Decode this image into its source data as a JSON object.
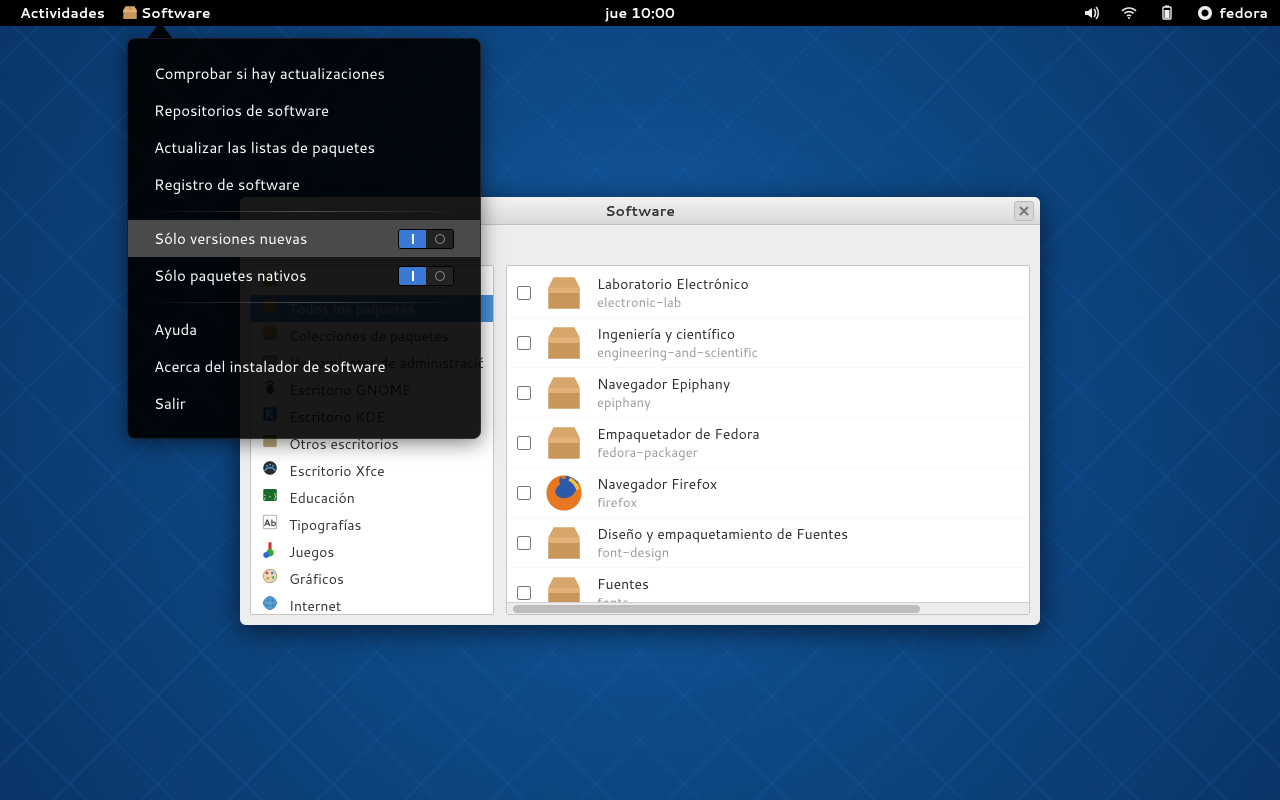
{
  "topbar": {
    "activities": "Actividades",
    "app_name": "Software",
    "clock": "jue 10:00",
    "username": "fedora"
  },
  "menu": {
    "check_updates": "Comprobar si hay actualizaciones",
    "software_repos": "Repositorios de software",
    "update_package_lists": "Actualizar las listas de paquetes",
    "software_log": "Registro de software",
    "only_new_versions": "Sólo versiones nuevas",
    "only_native_packages": "Sólo paquetes nativos",
    "help": "Ayuda",
    "about": "Acerca del instalador de software",
    "quit": "Salir"
  },
  "window": {
    "title": "Software"
  },
  "sidebar": {
    "items": [
      {
        "label": "",
        "icon": "box"
      },
      {
        "label": "Todos los paquetes",
        "icon": "box",
        "selected": true
      },
      {
        "label": "Colecciones de paquetes",
        "icon": "box"
      },
      {
        "label": "Herramientas de administración",
        "icon": "admin"
      },
      {
        "label": "Escritorio GNOME",
        "icon": "foot"
      },
      {
        "label": "Escritorio KDE",
        "icon": "kde"
      },
      {
        "label": "Otros escritorios",
        "icon": "window"
      },
      {
        "label": "Escritorio Xfce",
        "icon": "xfce"
      },
      {
        "label": "Educación",
        "icon": "edu"
      },
      {
        "label": "Tipografías",
        "icon": "font"
      },
      {
        "label": "Juegos",
        "icon": "games"
      },
      {
        "label": "Gráficos",
        "icon": "graphics"
      },
      {
        "label": "Internet",
        "icon": "globe"
      }
    ]
  },
  "packages": [
    {
      "name": "Laboratorio Electrónico",
      "id": "electronic-lab",
      "icon": "box"
    },
    {
      "name": "Ingeniería y científico",
      "id": "engineering-and-scientific",
      "icon": "box"
    },
    {
      "name": "Navegador Epiphany",
      "id": "epiphany",
      "icon": "box"
    },
    {
      "name": "Empaquetador de Fedora",
      "id": "fedora-packager",
      "icon": "box"
    },
    {
      "name": "Navegador Firefox",
      "id": "firefox",
      "icon": "firefox"
    },
    {
      "name": "Diseño y empaquetamiento de Fuentes",
      "id": "font-design",
      "icon": "box"
    },
    {
      "name": "Fuentes",
      "id": "fonts",
      "icon": "box"
    }
  ]
}
